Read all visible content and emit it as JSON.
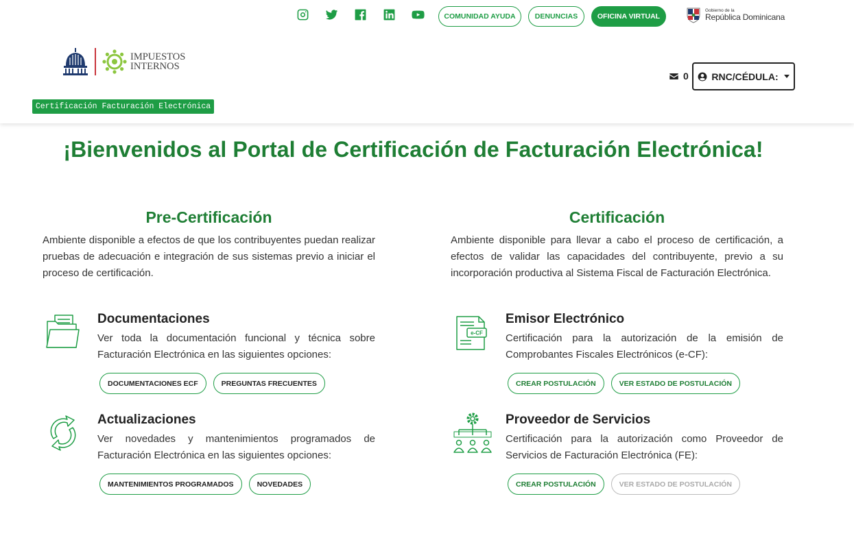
{
  "header": {
    "social": [
      "instagram-icon",
      "twitter-icon",
      "facebook-icon",
      "linkedin-icon",
      "youtube-icon"
    ],
    "links": {
      "comunidad": "COMUNIDAD AYUDA",
      "denuncias": "DENUNCIAS",
      "oficina": "OFICINA VIRTUAL"
    },
    "gov": {
      "small": "Gobierno de la",
      "big": "República Dominicana"
    },
    "logo": {
      "line1": "IMPUESTOS",
      "line2": "INTERNOS"
    },
    "tag": "Certificación Facturación Electrónica",
    "mail_count": "0",
    "rnc_label": "RNC/CÉDULA:"
  },
  "main": {
    "welcome": "¡Bienvenidos al Portal de Certificación de Facturación Electrónica!",
    "pre": {
      "title": "Pre-Certificación",
      "desc": "Ambiente disponible a efectos de que los contribuyentes puedan realizar pruebas de adecuación e integración de sus sistemas previo a iniciar el proceso de certificación.",
      "doc": {
        "title": "Documentaciones",
        "desc": "Ver toda la documentación funcional y técnica sobre Facturación Electrónica en las siguientes opciones:",
        "btn1": "DOCUMENTACIONES ECF",
        "btn2": "PREGUNTAS FRECUENTES"
      },
      "upd": {
        "title": "Actualizaciones",
        "desc": "Ver novedades y mantenimientos programados de Facturación Electrónica en las siguientes opciones:",
        "btn1": "MANTENIMIENTOS PROGRAMADOS",
        "btn2": "NOVEDADES"
      }
    },
    "cert": {
      "title": "Certificación",
      "desc": "Ambiente disponible para llevar a cabo el proceso de certificación, a efectos de validar las capacidades del contribuyente, previo a su incorporación productiva al Sistema Fiscal de Facturación Electrónica.",
      "emisor": {
        "title": "Emisor Electrónico",
        "desc": "Certificación para la autorización de la emisión de Comprobantes Fiscales Electrónicos (e-CF):",
        "icon_text": "e-CF",
        "btn1": "CREAR POSTULACIÓN",
        "btn2": "VER ESTADO DE POSTULACIÓN"
      },
      "proveedor": {
        "title": "Proveedor de Servicios",
        "desc": "Certificación para la autorización como Proveedor de Servicios de Facturación Electrónica (FE):",
        "btn1": "CREAR POSTULACIÓN",
        "btn2": "VER ESTADO DE POSTULACIÓN"
      }
    }
  },
  "colors": {
    "brand_green": "#1e9d45",
    "title_green": "#1e7e34",
    "accent_red": "#c8323a",
    "navy": "#1f3a6e"
  }
}
